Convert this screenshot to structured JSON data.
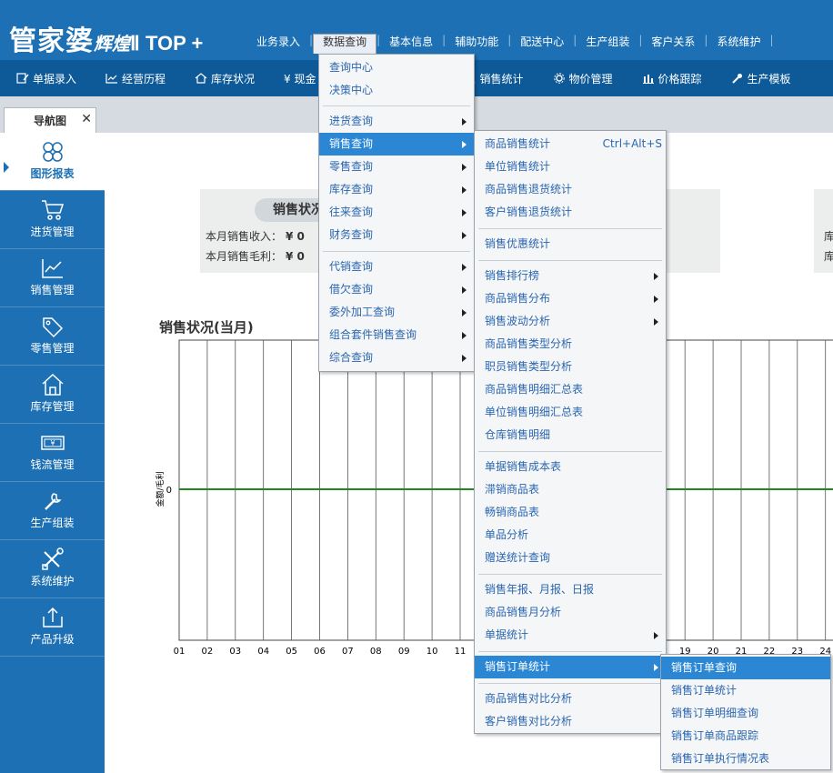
{
  "logo": {
    "brand": "管家婆",
    "edition": "辉煌",
    "version": "Ⅱ TOP +"
  },
  "top_nav": [
    "业务录入",
    "数据查询",
    "基本信息",
    "辅助功能",
    "配送中心",
    "生产组装",
    "客户关系",
    "系统维护"
  ],
  "toolbar": [
    {
      "label": "单据录入",
      "icon": "document-edit-icon"
    },
    {
      "label": "经营历程",
      "icon": "trend-chart-icon"
    },
    {
      "label": "库存状况",
      "icon": "home-icon"
    },
    {
      "label": "¥ 现金",
      "icon": ""
    },
    {
      "label": "销售统计",
      "icon": "search-icon"
    },
    {
      "label": "物价管理",
      "icon": "gear-icon"
    },
    {
      "label": "价格跟踪",
      "icon": "bar-chart-icon"
    },
    {
      "label": "生产模板",
      "icon": "wrench-icon"
    }
  ],
  "tab": {
    "label": "导航图",
    "close": "✕"
  },
  "sidebar": [
    {
      "label": "图形报表",
      "icon": "clover-icon"
    },
    {
      "label": "进货管理",
      "icon": "cart-icon"
    },
    {
      "label": "销售管理",
      "icon": "line-chart-icon"
    },
    {
      "label": "零售管理",
      "icon": "tag-icon"
    },
    {
      "label": "库存管理",
      "icon": "house-icon"
    },
    {
      "label": "钱流管理",
      "icon": "money-icon"
    },
    {
      "label": "生产组装",
      "icon": "wrench-icon"
    },
    {
      "label": "系统维护",
      "icon": "tools-icon"
    },
    {
      "label": "产品升级",
      "icon": "upload-icon"
    }
  ],
  "summary": {
    "title": "销售状况",
    "income_label": "本月销售收入：",
    "income_value": "¥ 0",
    "profit_label": "本月销售毛利：",
    "profit_value": "¥ 0",
    "right_label1": "库",
    "right_label2": "库"
  },
  "chart_data": {
    "type": "line",
    "title": "销售状况(当月)",
    "ylabel": "金额/毛利",
    "x_visible_left": [
      "01",
      "02",
      "03",
      "04",
      "05",
      "06",
      "07",
      "08",
      "09",
      "10",
      "11"
    ],
    "x_visible_right": [
      "19",
      "20",
      "21",
      "22",
      "23",
      "24"
    ],
    "y_ticks": [
      "0"
    ],
    "series": [
      {
        "values": [
          0,
          0,
          0,
          0,
          0,
          0,
          0,
          0,
          0,
          0,
          0,
          0,
          0,
          0,
          0,
          0,
          0,
          0,
          0,
          0,
          0,
          0,
          0,
          0
        ]
      }
    ],
    "line_color": "#1e8a1e"
  },
  "menu1": {
    "items": [
      {
        "label": "查询中心",
        "sub": false
      },
      {
        "label": "决策中心",
        "sub": false
      },
      {
        "label": "进货查询",
        "sub": true
      },
      {
        "label": "销售查询",
        "sub": true,
        "highlighted": true
      },
      {
        "label": "零售查询",
        "sub": true
      },
      {
        "label": "库存查询",
        "sub": true
      },
      {
        "label": "往来查询",
        "sub": true
      },
      {
        "label": "财务查询",
        "sub": true
      },
      {
        "label": "代销查询",
        "sub": true
      },
      {
        "label": "借欠查询",
        "sub": true
      },
      {
        "label": "委外加工查询",
        "sub": true
      },
      {
        "label": "组合套件销售查询",
        "sub": true
      },
      {
        "label": "综合查询",
        "sub": true
      }
    ]
  },
  "menu2": {
    "items": [
      {
        "label": "商品销售统计",
        "shortcut": "Ctrl+Alt+S"
      },
      {
        "label": "单位销售统计"
      },
      {
        "label": "商品销售退货统计"
      },
      {
        "label": "客户销售退货统计"
      },
      {
        "label": "销售优惠统计"
      },
      {
        "label": "销售排行榜",
        "sub": true
      },
      {
        "label": "商品销售分布",
        "sub": true
      },
      {
        "label": "销售波动分析",
        "sub": true
      },
      {
        "label": "商品销售类型分析"
      },
      {
        "label": "职员销售类型分析"
      },
      {
        "label": "商品销售明细汇总表"
      },
      {
        "label": "单位销售明细汇总表"
      },
      {
        "label": "仓库销售明细"
      },
      {
        "label": "单据销售成本表"
      },
      {
        "label": "滞销商品表"
      },
      {
        "label": "畅销商品表"
      },
      {
        "label": "单品分析"
      },
      {
        "label": "赠送统计查询"
      },
      {
        "label": "销售年报、月报、日报"
      },
      {
        "label": "商品销售月分析"
      },
      {
        "label": "单据统计",
        "sub": true
      },
      {
        "label": "销售订单统计",
        "sub": true,
        "highlighted": true
      },
      {
        "label": "商品销售对比分析"
      },
      {
        "label": "客户销售对比分析"
      }
    ]
  },
  "menu3": {
    "items": [
      {
        "label": "销售订单查询",
        "highlighted": true
      },
      {
        "label": "销售订单统计"
      },
      {
        "label": "销售订单明细查询"
      },
      {
        "label": "销售订单商品跟踪"
      },
      {
        "label": "销售订单执行情况表"
      }
    ]
  }
}
